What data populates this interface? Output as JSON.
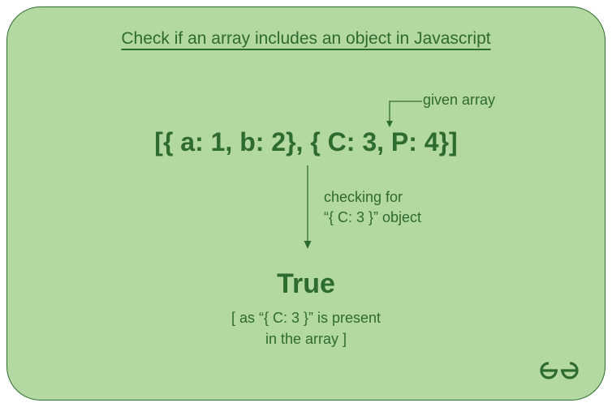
{
  "title": "Check if an array includes an object in Javascript",
  "givenArrayLabel": "given array",
  "arrayLiteral": "[{ a: 1, b: 2}, { C: 3, P: 4}]",
  "checkingLine1": "checking for",
  "checkingLine2": "“{ C: 3 }” object",
  "result": "True",
  "explainLine1": "[ as “{ C: 3 }” is present",
  "explainLine2": "in the array ]",
  "colors": {
    "background": "#b3d8a2",
    "foreground": "#2e6b2e"
  }
}
